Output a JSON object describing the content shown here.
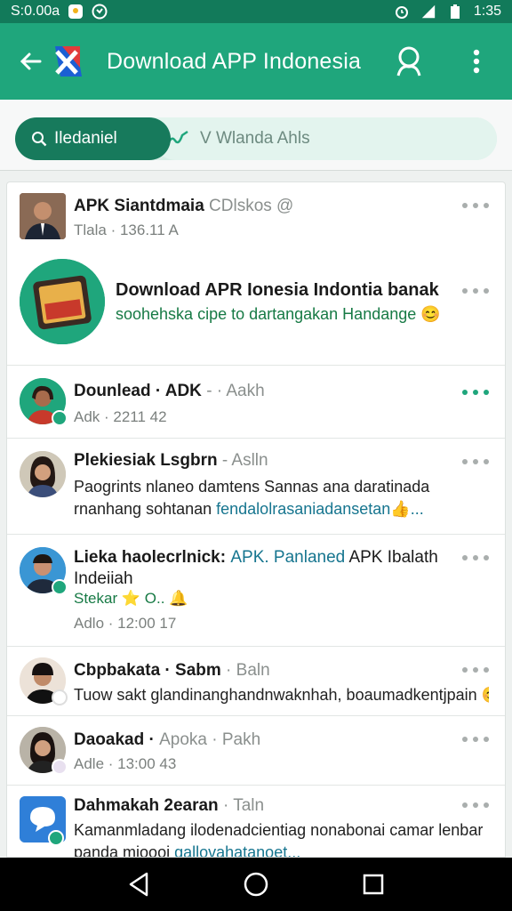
{
  "status_bar": {
    "time_left": "S:0.00a",
    "time_right": "1:35"
  },
  "app_bar": {
    "title": "Download APP Indonesia"
  },
  "search": {
    "segment_label": "Iledaniel",
    "placeholder": "V Wlanda Ahls"
  },
  "feed": {
    "items": [
      {
        "title": "APK Siantdmaia",
        "handle": "CDlskos @",
        "meta": "Tlala · 136.11  A"
      },
      {
        "title": "Download APR Ionesia Indontia banak",
        "subtitle": "soohehska cipe to dartangakan Handange 😊"
      },
      {
        "title": "Dounlead · ADK",
        "handle": "- · Aakh",
        "meta": "Adk · 2211 42"
      },
      {
        "title": "Plekiesiak Lsgbrn",
        "handle": "- Aslln",
        "body_text": "Paogrints nlaneo damtens Sannas ana daratinada rnanhang sohtanan ",
        "body_link": "fendalolrasaniadansetan👍..."
      },
      {
        "title": "Lieka haolecrlnick: ",
        "title_link": "APK. Panlaned",
        "title_rest": " APK Ibalath Indeiiah",
        "tag": "Stekar ⭐ O.. 🔔",
        "meta": "Adlo · 12:00 17"
      },
      {
        "title": "Cbpbakata · Sabm",
        "handle": "· Baln",
        "body_text": "Tuow sakt glandinanghandnwaknhah, boaumadkentjpain 😊"
      },
      {
        "title": "Daoakad ·",
        "handle": "Apoka · Pakh",
        "meta": "Adle · 13:00 43"
      },
      {
        "title": "Dahmakah 2earan",
        "handle": "· Taln",
        "body_text": "Kamanmladang ilodenadcientiag nonabonai camar lenbar panda mioooi ",
        "body_link": "gallovahatanoet..."
      }
    ]
  },
  "colors": {
    "status_bar": "#127a5a",
    "app_bar": "#1fa67c",
    "accent_dark": "#177a5c",
    "link": "#16758f"
  },
  "icons": [
    "back-arrow-icon",
    "app-logo-icon",
    "search-icon",
    "more-vert-icon",
    "alarm-icon",
    "signal-icon",
    "battery-icon",
    "nav-back-icon",
    "nav-home-icon",
    "nav-recents-icon"
  ]
}
